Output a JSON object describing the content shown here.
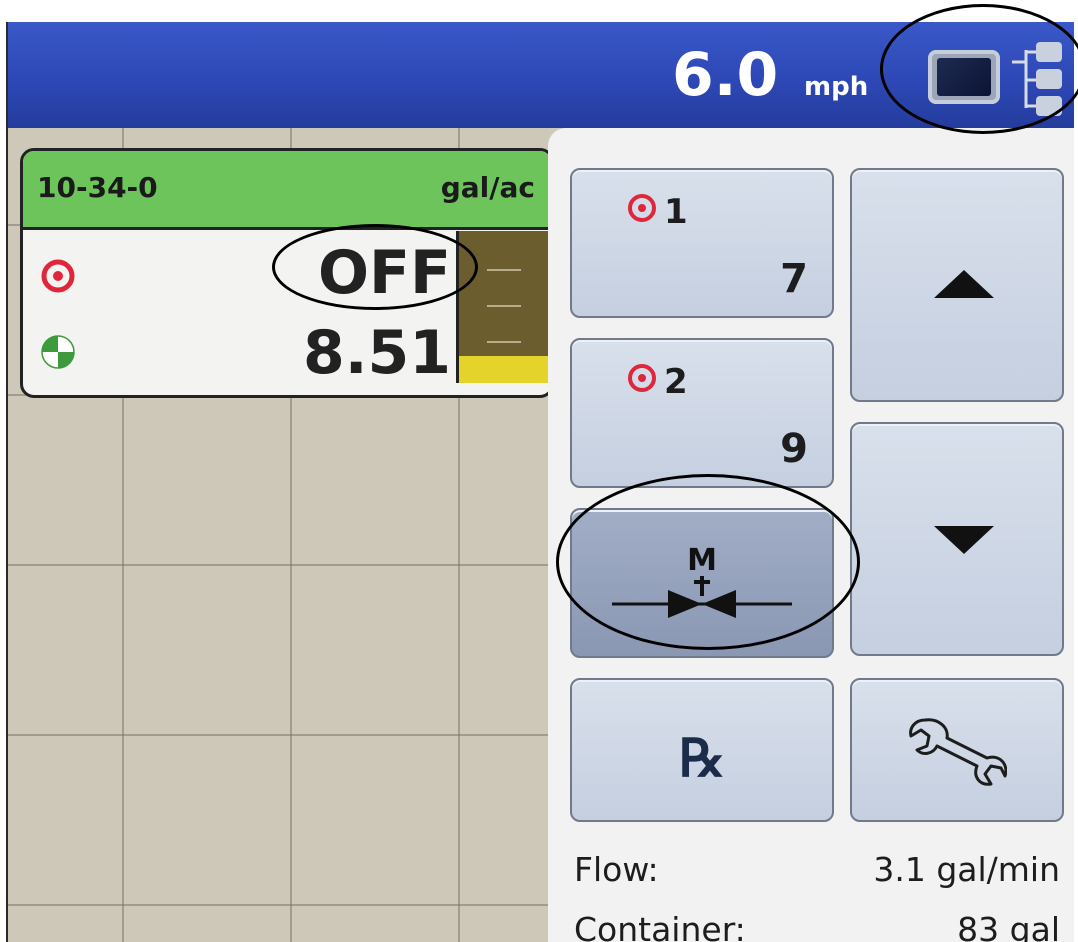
{
  "speed": {
    "value": "6.0",
    "unit": "mph"
  },
  "product": {
    "name": "10-34-0",
    "rate_unit": "gal/ac",
    "target_rate": "OFF",
    "actual_rate": "8.51",
    "container_level_fraction": 0.18
  },
  "sections": [
    {
      "label": "1",
      "value": "7"
    },
    {
      "label": "2",
      "value": "9"
    }
  ],
  "manual_valve": {
    "label": "M"
  },
  "rx": {
    "label": "℞"
  },
  "info": {
    "flow_label": "Flow:",
    "flow_value": "3.1 gal/min",
    "container_label": "Container:",
    "container_value": "83 gal"
  },
  "colors": {
    "topbar": "#2c47b4",
    "product_header": "#6cc45a",
    "target_red": "#e0263a",
    "level_fill": "#e3d32b"
  },
  "icons": [
    "screen-view-icon",
    "tree-view-icon",
    "target-icon",
    "actual-rate-icon",
    "arrow-up-icon",
    "arrow-down-icon",
    "manual-valve-icon",
    "wrench-icon"
  ]
}
